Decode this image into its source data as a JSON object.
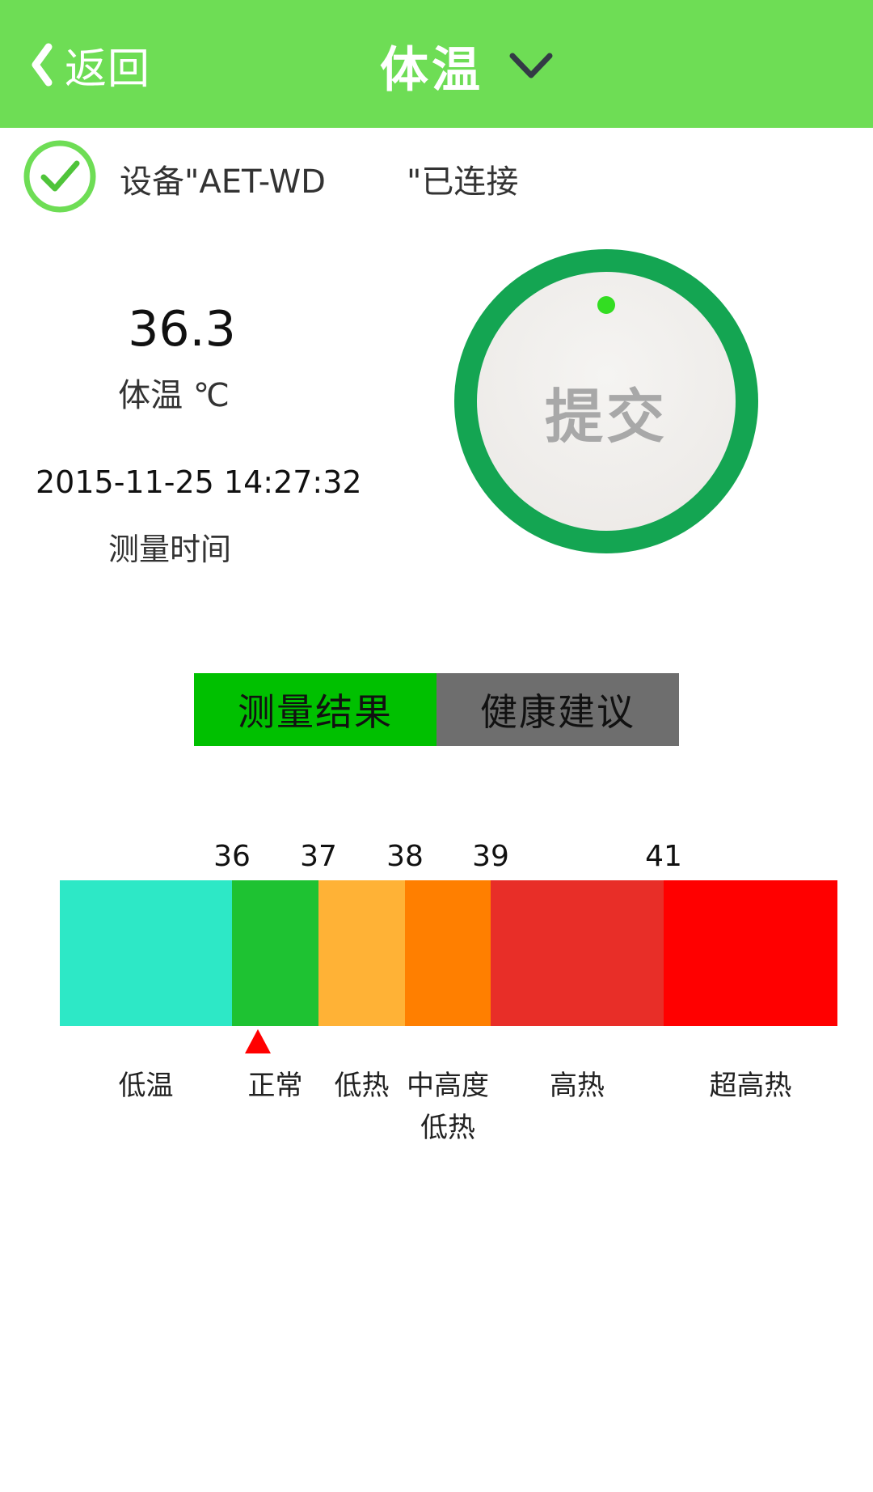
{
  "header": {
    "back_label": "返回",
    "title": "体温",
    "back_icon": "chevron-left-icon",
    "dropdown_icon": "chevron-down-icon",
    "background_color": "#6edd55"
  },
  "device": {
    "icon": "check-circle-icon",
    "prefix": "设备\"AET-WD",
    "suffix": "\"已连接"
  },
  "reading": {
    "value": "36.3",
    "label": "体温 ℃",
    "time": "2015-11-25 14:27:32",
    "time_label": "测量时间"
  },
  "submit": {
    "label": "提交",
    "ring_color": "#14a552",
    "dot_color": "#33dd22"
  },
  "tabs": [
    {
      "label": "测量结果",
      "active": true
    },
    {
      "label": "健康建议",
      "active": false
    }
  ],
  "scale": {
    "ticks": [
      "36",
      "37",
      "38",
      "39",
      "41"
    ],
    "segments": [
      {
        "label": "低温",
        "color": "#2de8c6"
      },
      {
        "label": "正常",
        "color": "#1ec232"
      },
      {
        "label": "低热",
        "color": "#ffb236"
      },
      {
        "label": "中高度\n低热",
        "color": "#ff7f00"
      },
      {
        "label": "高热",
        "color": "#e82e28"
      },
      {
        "label": "超高热",
        "color": "#ff0000"
      }
    ],
    "marker_value": 36.3,
    "marker_color": "#ff0000"
  }
}
